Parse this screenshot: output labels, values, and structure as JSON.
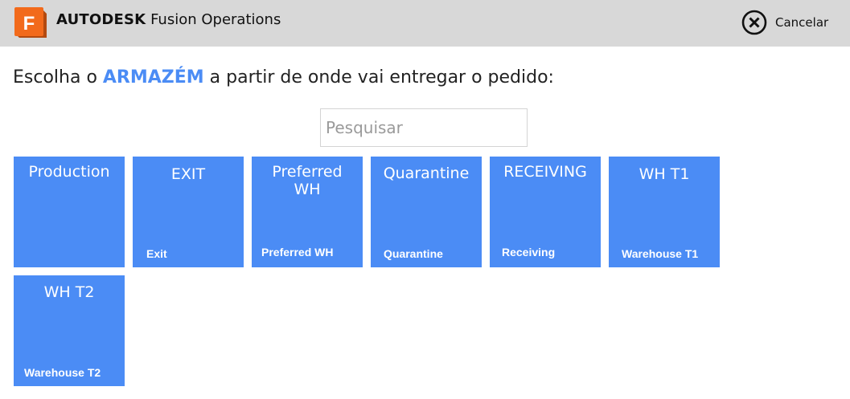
{
  "header": {
    "logo_letter": "F",
    "brand_name": "AUTODESK",
    "product_name": "Fusion Operations",
    "cancel_label": "Cancelar",
    "background": "#d8d8d8"
  },
  "prompt": {
    "before": "Escolha o ",
    "highlight": "ARMAZÉM",
    "after": " a partir de onde vai entregar o pedido:",
    "accent_color": "#4b8cf5"
  },
  "search": {
    "placeholder": "Pesquisar",
    "value": ""
  },
  "warehouses": [
    {
      "name": "Production",
      "description": ""
    },
    {
      "name": "EXIT",
      "description": "Exit"
    },
    {
      "name": "Preferred WH",
      "description": "Preferred WH"
    },
    {
      "name": "Quarantine",
      "description": "Quarantine"
    },
    {
      "name": "RECEIVING",
      "description": "Receiving"
    },
    {
      "name": "WH T1",
      "description": "Warehouse T1"
    },
    {
      "name": "WH T2",
      "description": "Warehouse T2"
    }
  ],
  "tile_color": "#4b8cf5"
}
